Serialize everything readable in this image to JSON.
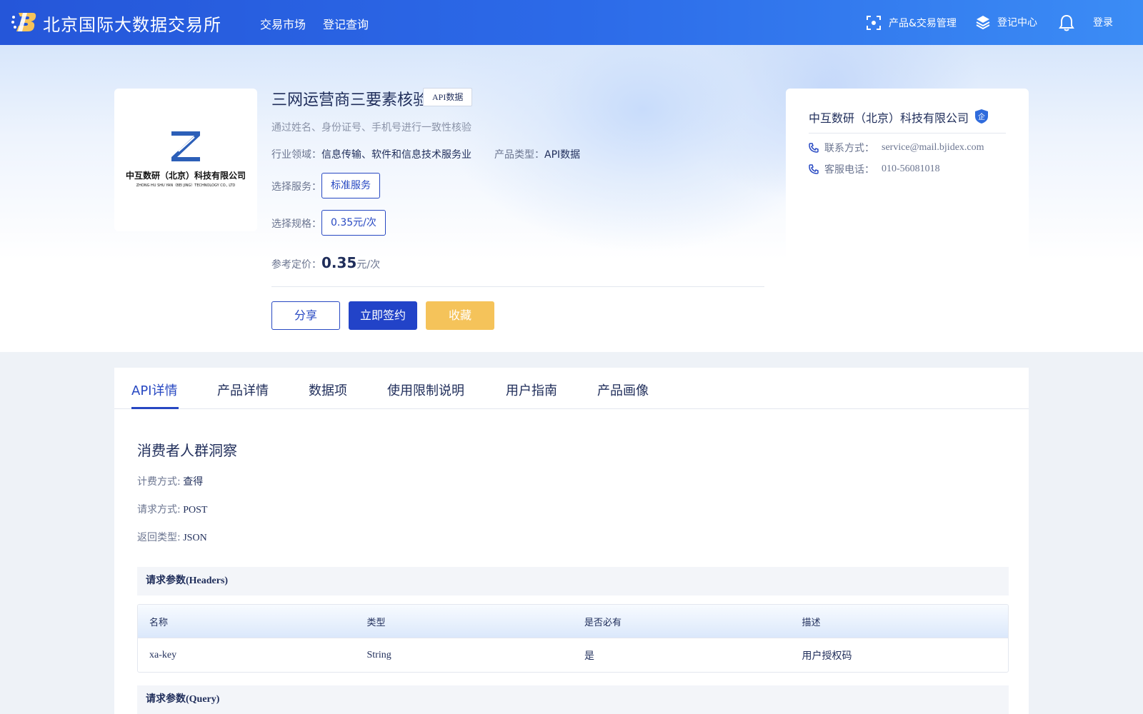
{
  "header": {
    "brand": "北京国际大数据交易所",
    "nav": [
      "交易市场",
      "登记查询"
    ],
    "product_mgmt": "产品&交易管理",
    "registration_center": "登记中心",
    "login": "登录"
  },
  "product": {
    "title": "三网运营商三要素核验",
    "tag": "API数据",
    "description": "通过姓名、身份证号、手机号进行一致性核验",
    "industry_label": "行业领域：",
    "industry_value": "信息传输、软件和信息技术服务业",
    "type_label": "产品类型：",
    "type_value": "API数据",
    "service_label": "选择服务：",
    "service_option": "标准服务",
    "spec_label": "选择规格：",
    "spec_option": "0.35元/次",
    "price_label": "参考定价：",
    "price_value": "0.35",
    "price_unit": "元/次",
    "share_button": "分享",
    "sign_button": "立即签约",
    "favorite_button": "收藏"
  },
  "logo": {
    "cn": "中互数研（北京）科技有限公司",
    "en": "ZHONG HU SHU YAN（BEI JING）TECHNOLOGY CO., LTD"
  },
  "company": {
    "name": "中互数研（北京）科技有限公司",
    "badge": "企",
    "contact_label": "联系方式：",
    "contact_value": "service@mail.bjidex.com",
    "phone_label": "客服电话：",
    "phone_value": "010-56081018"
  },
  "tabs": [
    "API详情",
    "产品详情",
    "数据项",
    "使用限制说明",
    "用户指南",
    "产品画像"
  ],
  "api": {
    "section_title": "消费者人群洞察",
    "billing_label": "计费方式:",
    "billing_value": "查得",
    "method_label": "请求方式:",
    "method_value": "POST",
    "return_label": "返回类型:",
    "return_value": "JSON",
    "headers_title": "请求参数(Headers)",
    "query_title": "请求参数(Query)",
    "table_columns": [
      "名称",
      "类型",
      "是否必有",
      "描述"
    ],
    "table_rows": [
      [
        "xa-key",
        "String",
        "是",
        "用户授权码"
      ]
    ]
  },
  "colors": {
    "primary": "#2748c2",
    "header_gradient_start": "#2556d9",
    "header_gradient_end": "#3b8cf5",
    "favorite": "#f5c35a"
  }
}
